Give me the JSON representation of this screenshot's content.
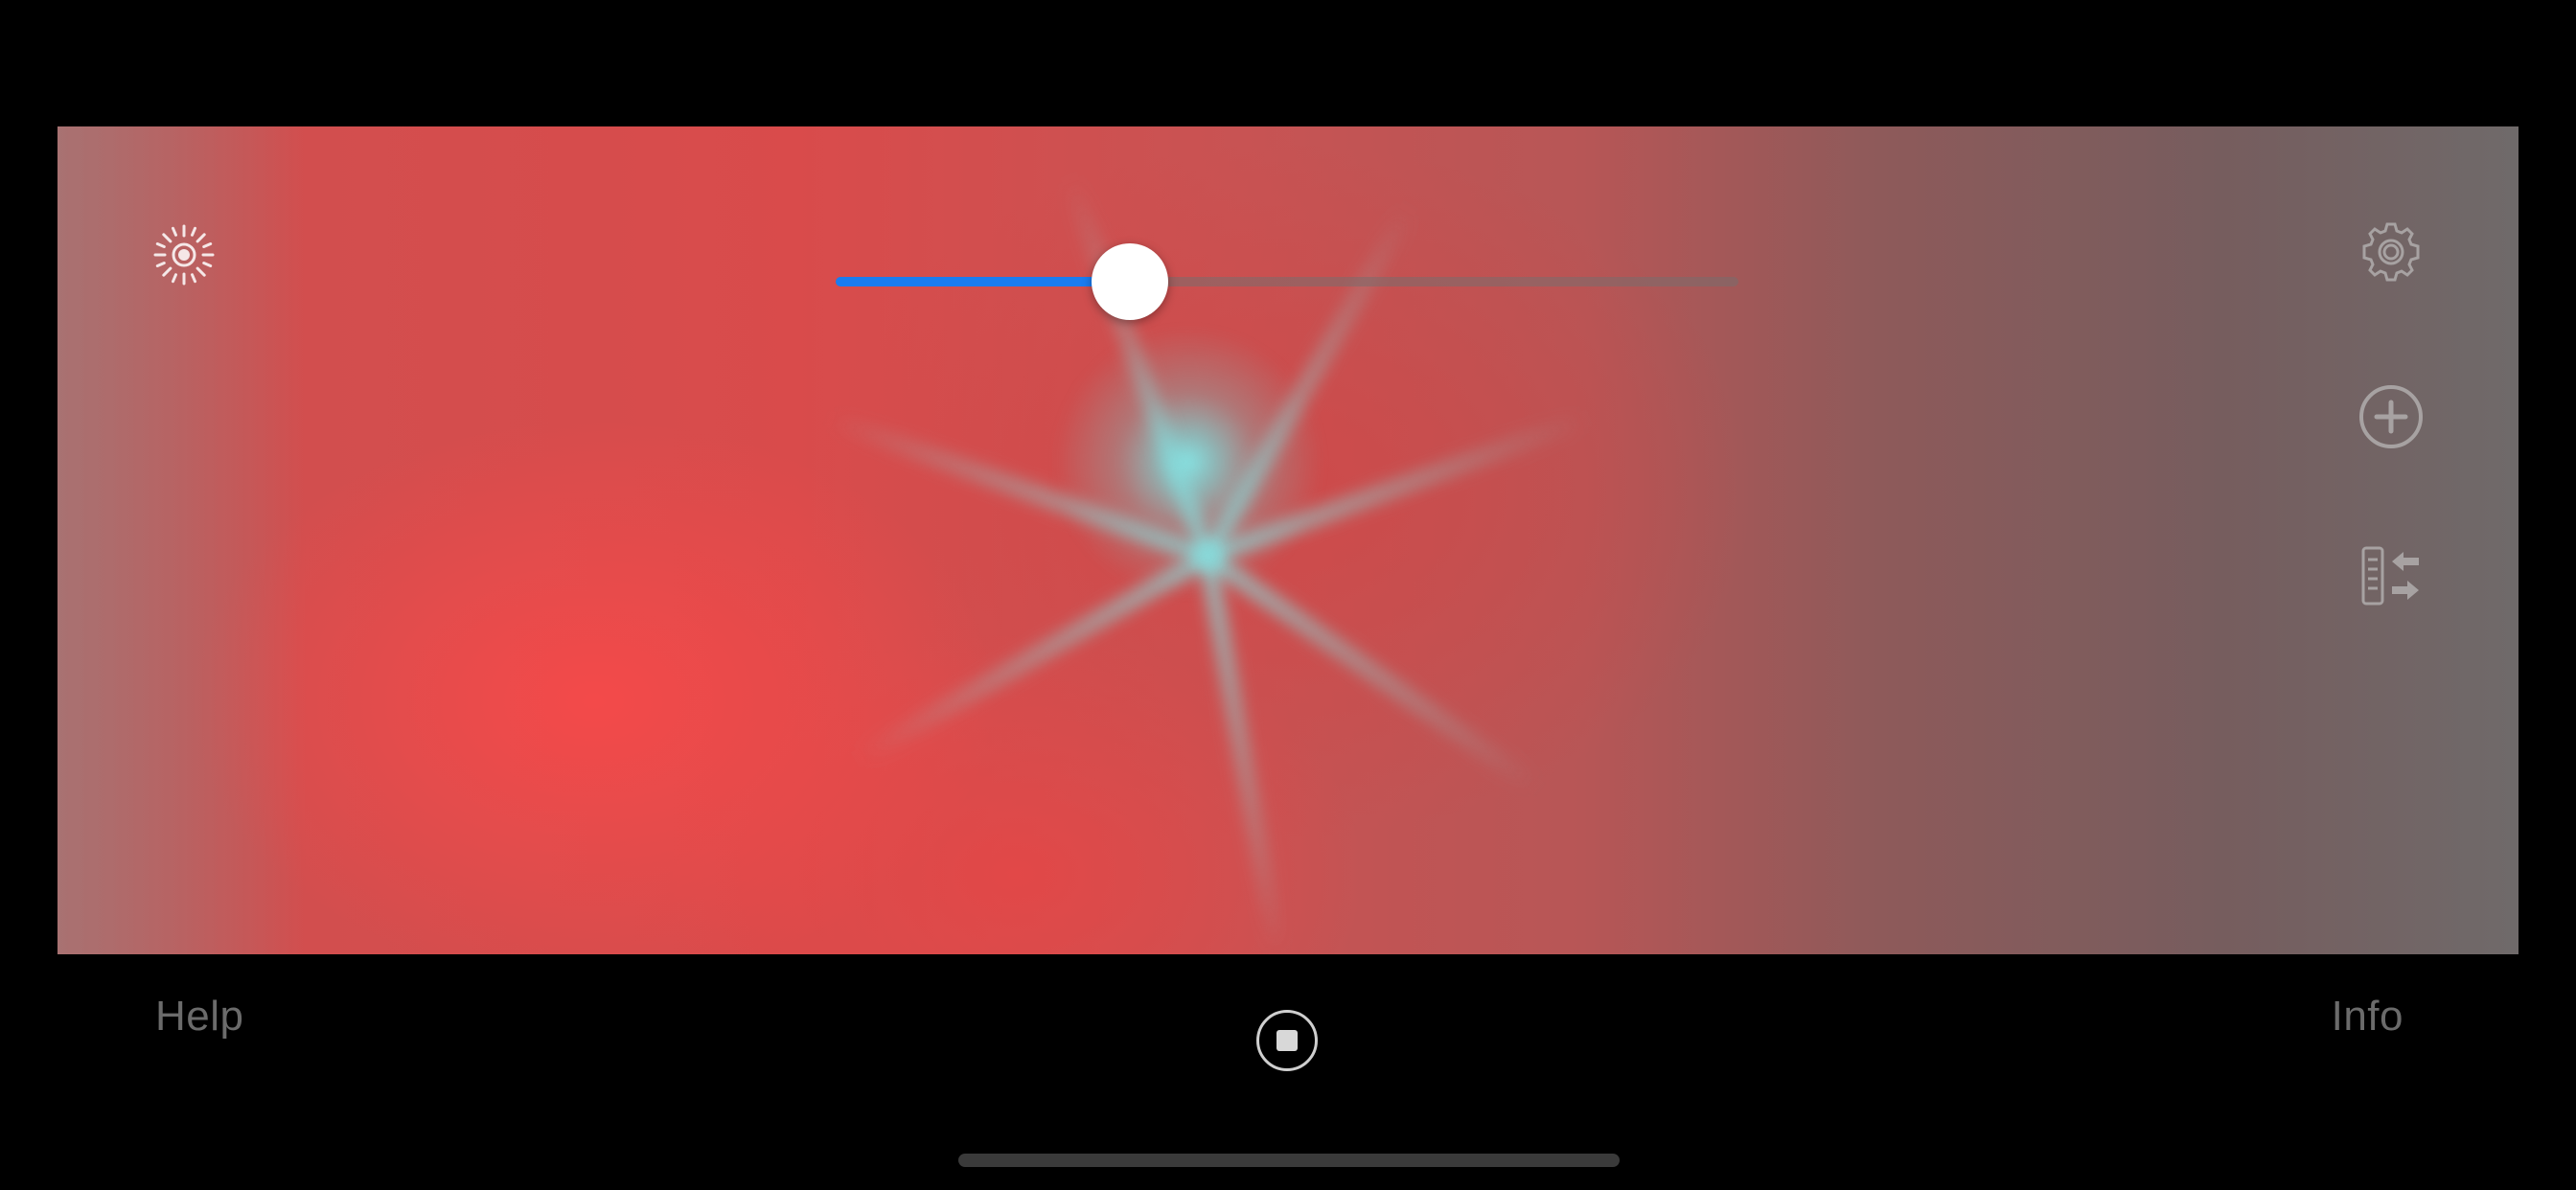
{
  "visualizer": {
    "colors": {
      "primary": "#d94b4b",
      "secondary": "#765d5e",
      "burst": "#82ebeb"
    }
  },
  "slider": {
    "value": 0.326,
    "fill_color": "#1a7cf0",
    "track_color": "#6e6464",
    "thumb_color": "#ffffff"
  },
  "icons": {
    "brightness": "sun-icon",
    "settings": "gear-icon",
    "add": "plus-circle-icon",
    "swap": "swap-list-icon",
    "stop": "stop-icon"
  },
  "bottom_bar": {
    "help_label": "Help",
    "info_label": "Info"
  }
}
